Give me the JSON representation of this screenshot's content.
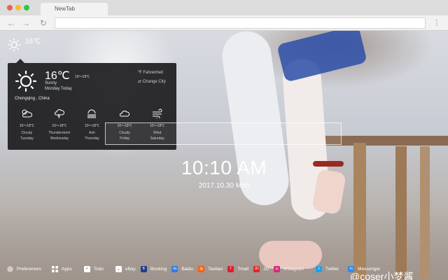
{
  "browser": {
    "tab_title": "NewTab",
    "nav": {
      "back_icon": "back-arrow-icon",
      "forward_icon": "forward-arrow-icon",
      "reload_icon": "reload-icon"
    },
    "address": ""
  },
  "weather_mini": {
    "temp": "16℃",
    "icon": "sun-icon"
  },
  "weather_panel": {
    "temp": "16℃",
    "range": "10～18℃",
    "condition": "Sunny",
    "day": "Monday Today",
    "location": "Chongqing , China",
    "fahrenheit_label": "℉ Fahrenheit",
    "change_city_label": "⇄ Change City",
    "forecast": [
      {
        "range": "10～18℃",
        "condition": "Cloudy",
        "day": "Tuesday",
        "icon": "cloud-sun-icon"
      },
      {
        "range": "10～18℃",
        "condition": "Thunderstorm",
        "day": "Wednesday",
        "icon": "thunderstorm-icon"
      },
      {
        "range": "10～18℃",
        "condition": "Ash",
        "day": "Thursday",
        "icon": "haze-icon"
      },
      {
        "range": "10～18℃",
        "condition": "Cloudy",
        "day": "Friday",
        "icon": "cloud-icon"
      },
      {
        "range": "10～18℃",
        "condition": "Wind",
        "day": "Saturday",
        "icon": "wind-icon"
      }
    ]
  },
  "clock": {
    "time": "10:10 AM",
    "date": "2017.10.30 Mon"
  },
  "bottom_bar": [
    {
      "label": "Preferences",
      "icon": "gear-icon",
      "color": "#ffffff"
    },
    {
      "label": "Apps",
      "icon": "apps-grid-icon",
      "color": "#ffffff"
    },
    {
      "label": "Todo",
      "icon": "todo-check-icon",
      "color": "#ffffff"
    },
    {
      "label": "eBay",
      "icon": "ebay-icon",
      "color": "#ffffff"
    },
    {
      "label": "Booking",
      "icon": "booking-icon",
      "color": "#1c3f8c"
    },
    {
      "label": "Baidu",
      "icon": "baidu-icon",
      "color": "#2d7be5"
    },
    {
      "label": "Taobao",
      "icon": "taobao-icon",
      "color": "#ff5a00"
    },
    {
      "label": "Tmall",
      "icon": "tmall-icon",
      "color": "#e21a2c"
    },
    {
      "label": "JD",
      "icon": "jd-icon",
      "color": "#e1251b"
    },
    {
      "label": "Instagram",
      "icon": "instagram-icon",
      "color": "#d6297a"
    },
    {
      "label": "Twitter",
      "icon": "twitter-icon",
      "color": "#1da1f2"
    },
    {
      "label": "Messenger",
      "icon": "messenger-icon",
      "color": "#2f8bf2"
    }
  ],
  "watermark": "@coser小梦酱"
}
